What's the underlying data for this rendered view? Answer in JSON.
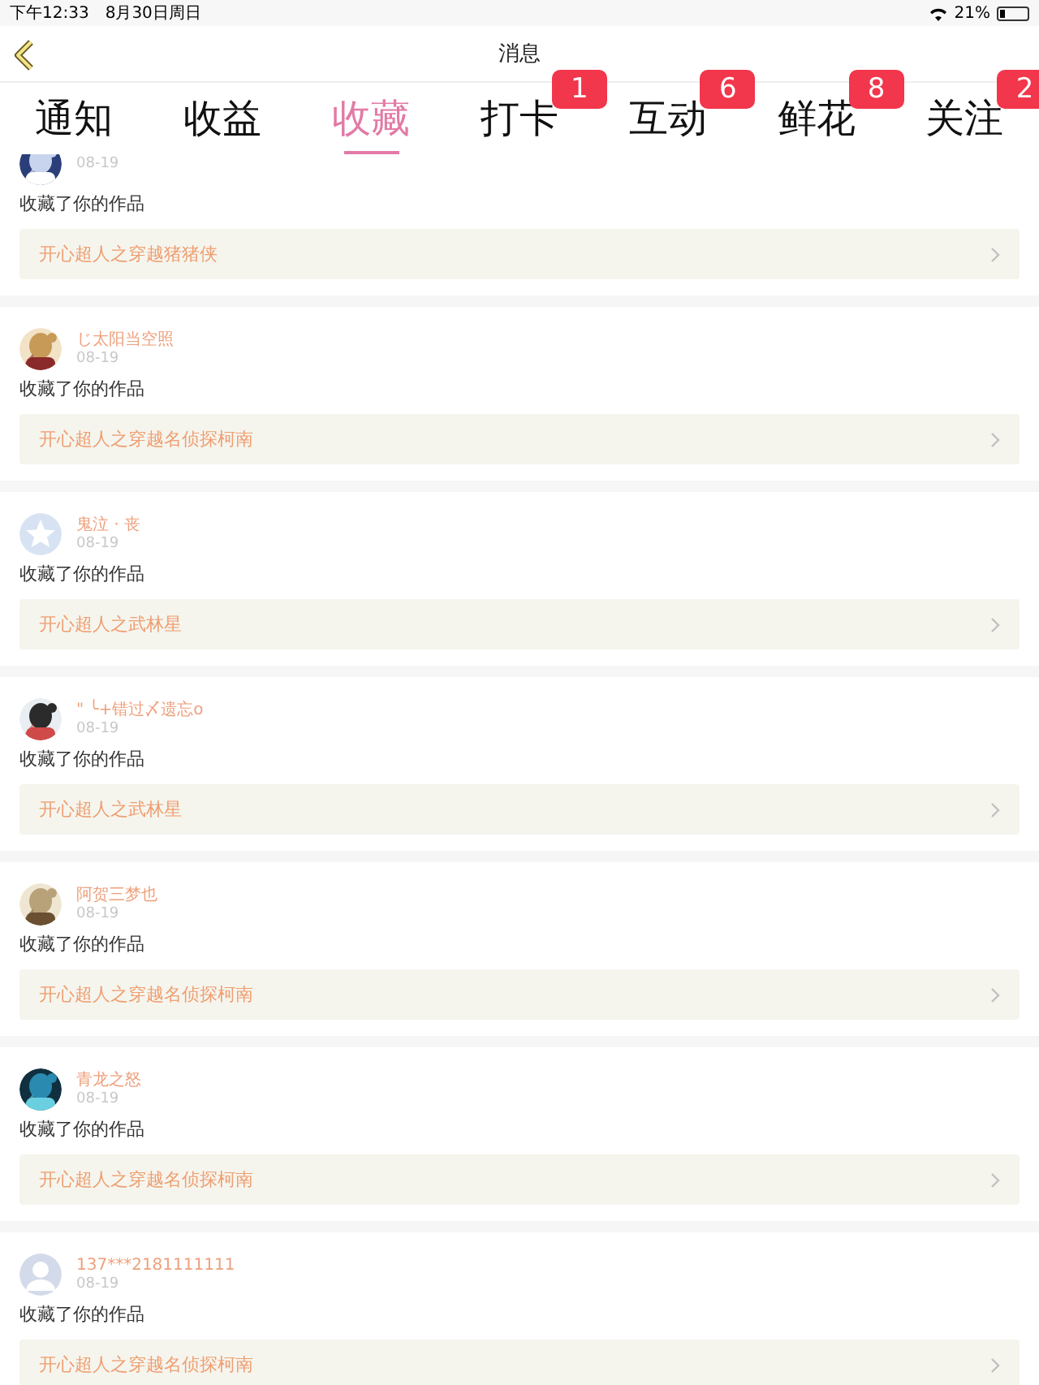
{
  "status_bar": {
    "time": "下午12:33",
    "date": "8月30日周日",
    "battery_percent": "21%"
  },
  "nav": {
    "title": "消息"
  },
  "tabs": [
    {
      "label": "通知",
      "selected": false
    },
    {
      "label": "收益",
      "selected": false
    },
    {
      "label": "收藏",
      "selected": true
    },
    {
      "label": "打卡",
      "selected": false,
      "badge": "1"
    },
    {
      "label": "互动",
      "selected": false,
      "badge": "6"
    },
    {
      "label": "鲜花",
      "selected": false,
      "badge": "8"
    },
    {
      "label": "关注",
      "selected": false,
      "badge": "2"
    }
  ],
  "items": [
    {
      "kind": "picture",
      "date": "08-19",
      "action": "收藏了你的作品",
      "work": "开心超人之穿越猪猪侠"
    },
    {
      "kind": "picture",
      "name": "じ太阳当空照",
      "date": "08-19",
      "action": "收藏了你的作品",
      "work": "开心超人之穿越名侦探柯南"
    },
    {
      "kind": "star",
      "name": "鬼泣 · 丧",
      "date": "08-19",
      "action": "收藏了你的作品",
      "work": "开心超人之武林星"
    },
    {
      "kind": "picture",
      "name": "\"  ╰+错过〆遗忘o",
      "date": "08-19",
      "action": "收藏了你的作品",
      "work": "开心超人之武林星"
    },
    {
      "kind": "picture",
      "name": "阿贺三梦也",
      "date": "08-19",
      "action": "收藏了你的作品",
      "work": "开心超人之穿越名侦探柯南"
    },
    {
      "kind": "picture",
      "name": "青龙之怒",
      "date": "08-19",
      "action": "收藏了你的作品",
      "work": "开心超人之穿越名侦探柯南"
    },
    {
      "kind": "silhouette",
      "name": "137***2181111111",
      "date": "08-19",
      "action": "收藏了你的作品",
      "work": "开心超人之穿越名侦探柯南"
    }
  ]
}
